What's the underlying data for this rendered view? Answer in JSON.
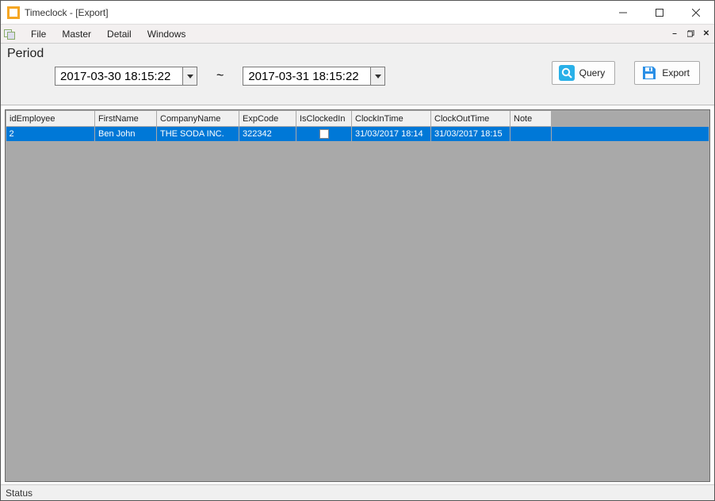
{
  "window": {
    "title": "Timeclock - [Export]"
  },
  "menu": {
    "items": [
      "File",
      "Master",
      "Detail",
      "Windows"
    ]
  },
  "panel": {
    "period_label": "Period",
    "from_value": "2017-03-30 18:15:22",
    "to_value": "2017-03-31 18:15:22",
    "separator": "~",
    "query_label": "Query",
    "export_label": "Export"
  },
  "grid": {
    "columns": [
      "idEmployee",
      "FirstName",
      "CompanyName",
      "ExpCode",
      "IsClockedIn",
      "ClockInTime",
      "ClockOutTime",
      "Note"
    ],
    "rows": [
      {
        "idEmployee": "2",
        "FirstName": "Ben John",
        "CompanyName": "THE SODA INC.",
        "ExpCode": "322342",
        "IsClockedIn": false,
        "ClockInTime": "31/03/2017 18:14",
        "ClockOutTime": "31/03/2017 18:15",
        "Note": ""
      }
    ]
  },
  "statusbar": {
    "text": "Status"
  }
}
